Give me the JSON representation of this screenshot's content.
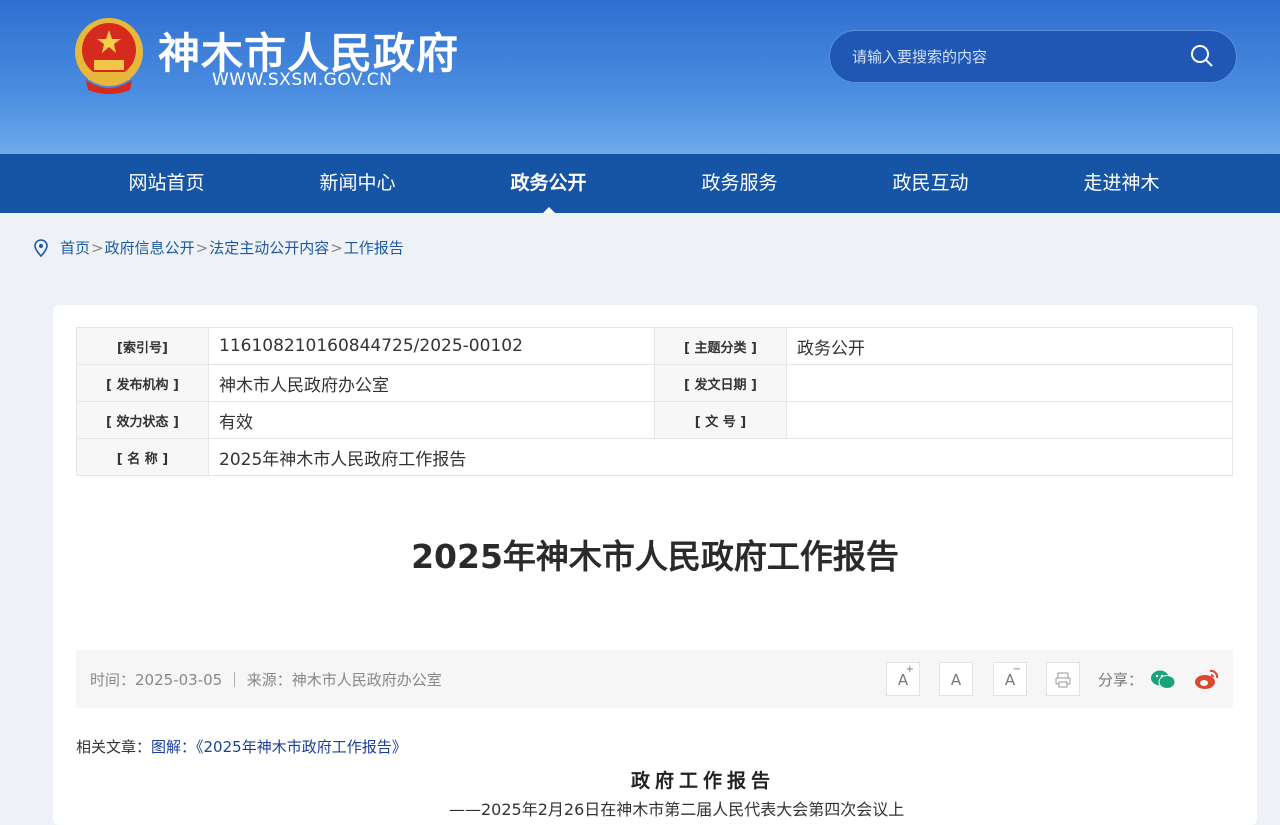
{
  "header": {
    "title": "神木市人民政府",
    "url": "WWW.SXSM.GOV.CN",
    "search_placeholder": "请输入要搜索的内容"
  },
  "nav": [
    "网站首页",
    "新闻中心",
    "政务公开",
    "政务服务",
    "政民互动",
    "走进神木"
  ],
  "nav_active": "政务公开",
  "breadcrumb": [
    "首页",
    "政府信息公开",
    "法定主动公开内容",
    "工作报告"
  ],
  "breadcrumb_sep": ">",
  "info_table": {
    "index_label": "[索引号]",
    "index_value": "116108210160844725/2025-00102",
    "topic_label": "[ 主题分类 ]",
    "topic_value": "政务公开",
    "publisher_label": "[ 发布机构 ]",
    "publisher_value": "神木市人民政府办公室",
    "date_label": "[ 发文日期 ]",
    "date_value": "",
    "status_label": "[ 效力状态 ]",
    "status_value": "有效",
    "docno_label": "[ 文 号 ]",
    "docno_value": "",
    "name_label": "[ 名 称 ]",
    "name_value": "2025年神木市人民政府工作报告"
  },
  "article": {
    "title": "2025年神木市人民政府工作报告",
    "meta": "时间：2025-03-05 ｜  来源：神木市人民政府办公室",
    "tools": {
      "enlarge": "A",
      "normal": "A",
      "shrink": "A",
      "plus": "+",
      "minus": "−"
    },
    "share_label": "分享：",
    "related_label": "相关文章：",
    "related_link": "图解：《2025年神木市政府工作报告》",
    "subtitle": "政府工作报告",
    "subline": "——2025年2月26日在神木市第二届人民代表大会第四次会议上"
  }
}
